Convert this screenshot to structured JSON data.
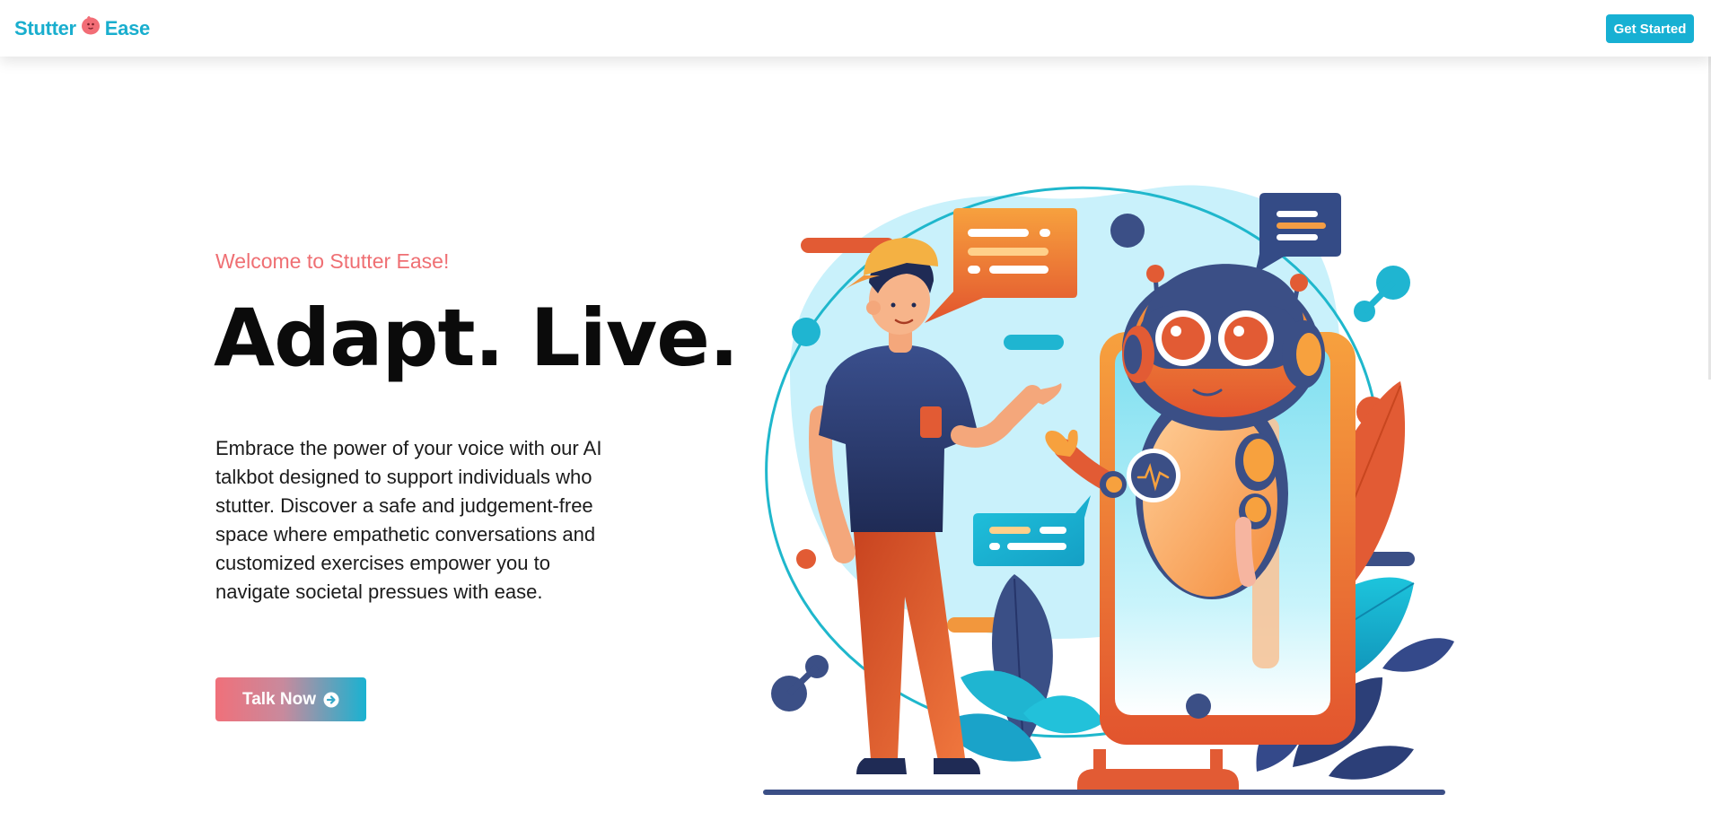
{
  "nav": {
    "brand_left": "Stutter",
    "brand_right": "Ease",
    "cta_label": "Get Started"
  },
  "hero": {
    "welcome": "Welcome to Stutter Ease!",
    "headline": "Adapt. Live.",
    "description": "Embrace the power of your voice with our AI talkbot designed to support individuals who stutter. Discover a safe and judgement-free space where empathetic conversations and customized exercises empower you to navigate societal pressues with ease.",
    "button_label": "Talk Now"
  },
  "icons": {
    "brand_mascot": "pink-blob-mascot-icon",
    "button_icon": "arrow-circle-right-icon"
  },
  "colors": {
    "brand": "#19aece",
    "accent_pink": "#ef6f73",
    "text_dark": "#0b0b0b",
    "button_gradient_start": "#f0707a",
    "button_gradient_end": "#19b2d1"
  }
}
